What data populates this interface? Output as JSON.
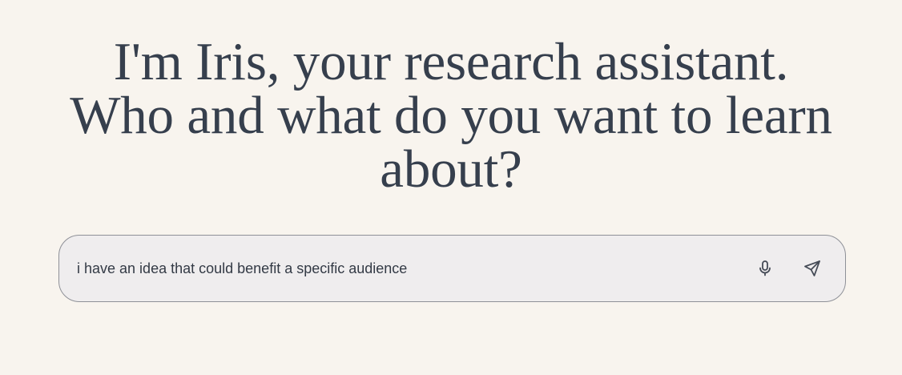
{
  "hero": {
    "lines": [
      "I'm Iris, your research assistant.",
      "Who and what do you want to learn",
      "about?"
    ]
  },
  "prompt": {
    "value": "i have an idea that could benefit a specific audience",
    "mic_icon": "microphone-icon",
    "send_icon": "send-icon"
  },
  "colors": {
    "background": "#f8f4ee",
    "heading": "#363f4d",
    "input_background": "#efedee",
    "input_border": "#8e9097"
  }
}
